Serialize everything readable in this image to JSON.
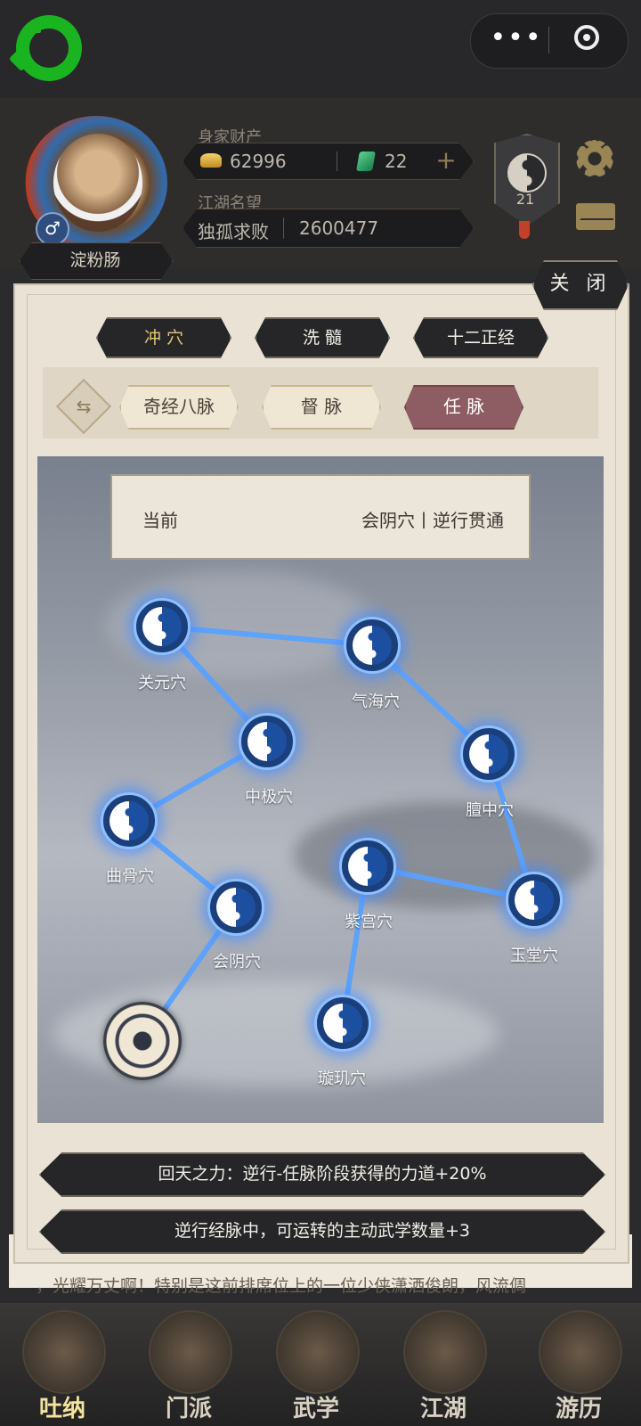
{
  "assets": {
    "money_title": "身家财产",
    "gold": "62996",
    "jade": "22",
    "plus": "+",
    "reputation_title": "江湖名望",
    "reputation_name": "独孤求败",
    "reputation_value": "2600477"
  },
  "player": {
    "name": "淀粉肠",
    "gender_symbol": "♂"
  },
  "level_badge": "21",
  "capsule": {
    "more": "•••"
  },
  "modal": {
    "close_label": "关 闭",
    "tabs": [
      "冲 穴",
      "洗 髓",
      "十二正经"
    ],
    "active_tab": 0,
    "subtabs": [
      "奇经八脉",
      "督 脉",
      "任 脉"
    ],
    "active_subtab": 2,
    "swap_glyph": "⇆",
    "current_label": "当前",
    "current_value": "会阴穴丨逆行贯通",
    "nodes": [
      "关元穴",
      "气海穴",
      "中极穴",
      "膻中穴",
      "曲骨穴",
      "紫宫穴",
      "玉堂穴",
      "会阴穴",
      "璇玑穴"
    ],
    "bonuses": [
      "回天之力：逆行-任脉阶段获得的力道+20%",
      "逆行经脉中，可运转的主动武学数量+3"
    ]
  },
  "background_text": "，光耀万丈啊！特别是这前排席位上的一位少侠潇洒俊朗，风流倜",
  "nav": [
    "吐纳",
    "门派",
    "武学",
    "江湖",
    "游历"
  ],
  "active_nav": 0,
  "colors": {
    "accent_gold": "#e9c76c",
    "node_blue": "#1d4fa0",
    "active_subtab": "#8e5d63",
    "logo_green": "#19b41f"
  }
}
